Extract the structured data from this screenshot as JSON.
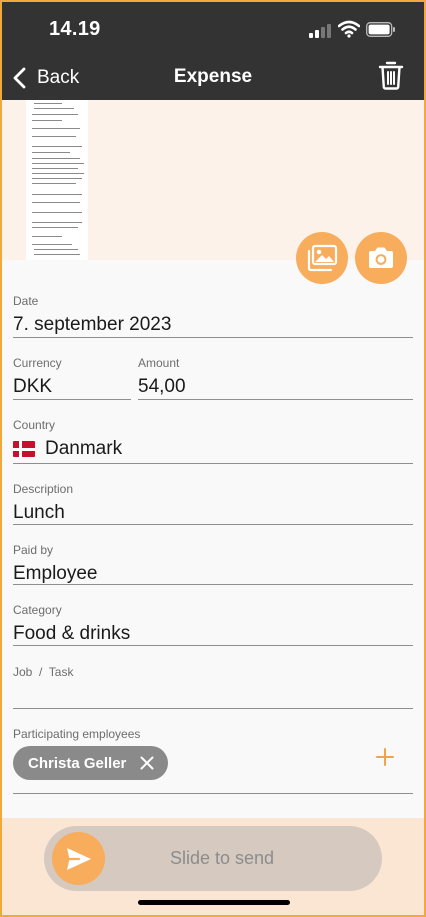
{
  "status_bar": {
    "time": "14.19"
  },
  "nav": {
    "back_label": "Back",
    "title": "Expense"
  },
  "form": {
    "date": {
      "label": "Date",
      "value": "7. september 2023"
    },
    "currency": {
      "label": "Currency",
      "value": "DKK"
    },
    "amount": {
      "label": "Amount",
      "value": "54,00"
    },
    "country": {
      "label": "Country",
      "value": "Danmark",
      "flag": "denmark-flag"
    },
    "description": {
      "label": "Description",
      "value": "Lunch"
    },
    "paid_by": {
      "label": "Paid by",
      "value": "Employee"
    },
    "category": {
      "label": "Category",
      "value": "Food & drinks"
    },
    "job_task": {
      "label": "Job  /  Task",
      "value": ""
    },
    "participants": {
      "label": "Participating employees",
      "items": [
        "Christa Geller"
      ]
    }
  },
  "slider": {
    "label": "Slide to send"
  },
  "colors": {
    "accent": "#f7ad5c",
    "topbar": "#333333",
    "chip": "#8a8a8a",
    "frame": "#f2a93b"
  }
}
